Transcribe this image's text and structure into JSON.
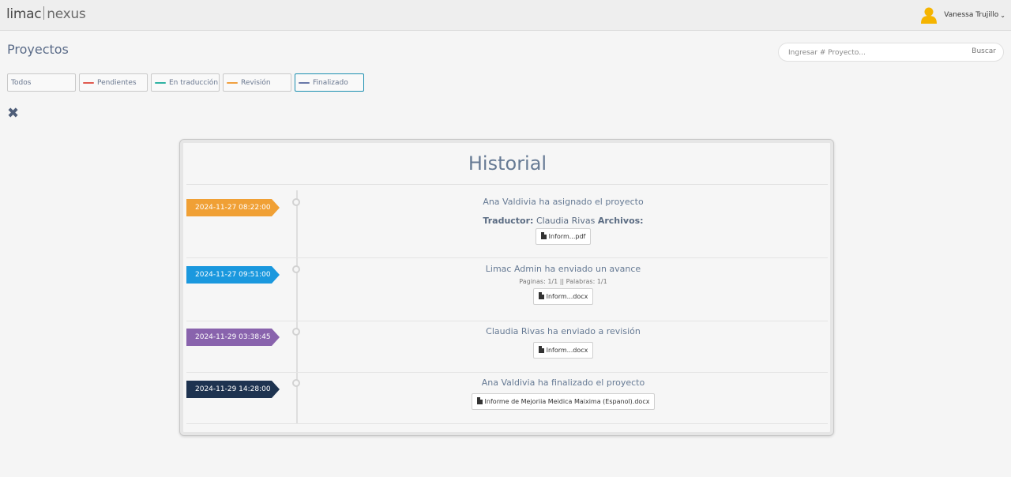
{
  "brand": {
    "part1": "limac",
    "part2": "nexus"
  },
  "user": {
    "name": "Vanessa Trujillo",
    "caret": "⌄",
    "avatar_icon": "user-avatar-icon"
  },
  "page": {
    "title": "Proyectos"
  },
  "search": {
    "placeholder": "Ingresar # Proyecto...",
    "button": "Buscar"
  },
  "filters": [
    {
      "label": "Todos",
      "color": "",
      "active": false
    },
    {
      "label": "Pendientes",
      "color": "#e05a4f",
      "active": false
    },
    {
      "label": "En traducción",
      "color": "#2fb3a3",
      "active": false
    },
    {
      "label": "Revisión",
      "color": "#f0a040",
      "active": false
    },
    {
      "label": "Finalizado",
      "color": "#6878a8",
      "active": true
    }
  ],
  "close_icon": "✖",
  "history": {
    "title": "Historial",
    "entries": [
      {
        "date": "2024-11-27 08:22:00",
        "color": "#f0a035",
        "title": "Ana Valdivia ha asignado el proyecto",
        "translator_label": "Traductor:",
        "translator": "Claudia Rivas",
        "files_label": "Archivos:",
        "file": "Inform...pdf"
      },
      {
        "date": "2024-11-27 09:51:00",
        "color": "#1a98de",
        "title": "Limac Admin ha enviado un avance",
        "details": "Paginas: 1/1 || Palabras: 1/1",
        "file": "Inform...docx"
      },
      {
        "date": "2024-11-29 03:38:45",
        "color": "#8963ad",
        "title": "Claudia Rivas ha enviado a revisión",
        "file": "Inform...docx"
      },
      {
        "date": "2024-11-29 14:28:00",
        "color": "#1e3350",
        "title": "Ana Valdivia ha finalizado el proyecto",
        "file": "Informe de Mejoriia Meidica Maixima (Espanol).docx"
      }
    ]
  }
}
